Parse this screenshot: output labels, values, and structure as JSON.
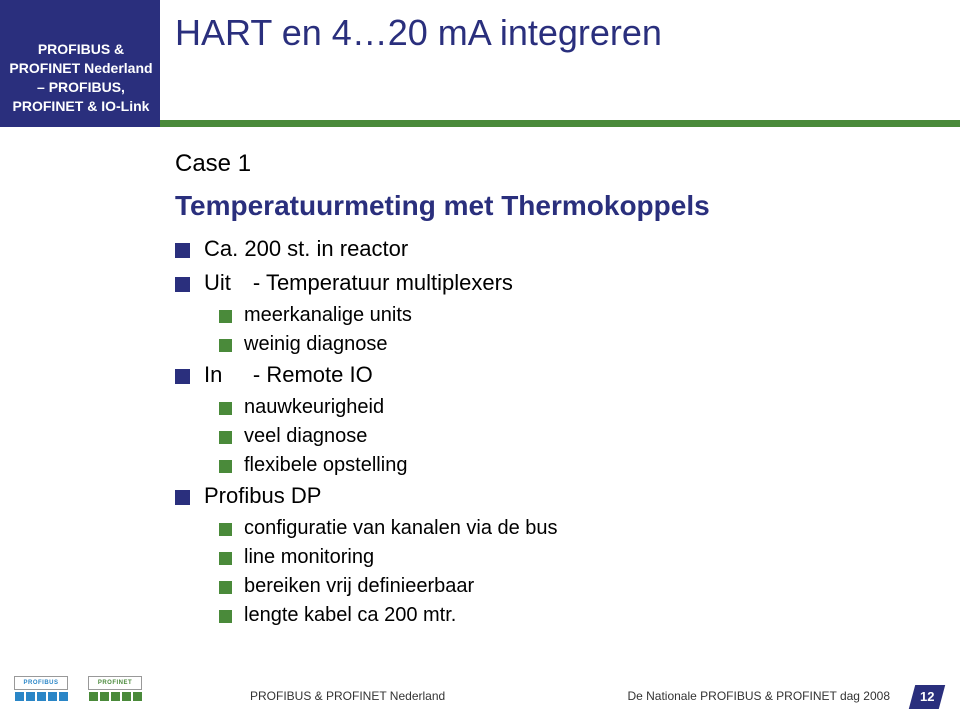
{
  "sidebar": {
    "l1": "PROFIBUS &",
    "l2": "PROFINET Nederland",
    "l3": "– PROFIBUS,",
    "l4": "PROFINET & IO-Link"
  },
  "title": "HART en 4…20 mA integreren",
  "case_label": "Case 1",
  "subheading": "Temperatuurmeting met Thermokoppels",
  "bullets": {
    "b1": "Ca. 200 st. in reactor",
    "b2": "Uit\t- Temperatuur multiplexers",
    "b2a": "meerkanalige units",
    "b2b": "weinig diagnose",
    "b3": "In\t- Remote IO",
    "b3a": "nauwkeurigheid",
    "b3b": "veel diagnose",
    "b3c": "flexibele opstelling",
    "b4": "Profibus DP",
    "b4a": "configuratie van kanalen via de bus",
    "b4b": "line monitoring",
    "b4c": "bereiken vrij definieerbaar",
    "b4d": "lengte kabel ca 200 mtr."
  },
  "footer": {
    "left": "PROFIBUS & PROFINET Nederland",
    "right": "De Nationale PROFIBUS & PROFINET dag 2008",
    "page": "12"
  },
  "logos": {
    "bus": "PROFIBUS",
    "net": "PROFINET"
  }
}
